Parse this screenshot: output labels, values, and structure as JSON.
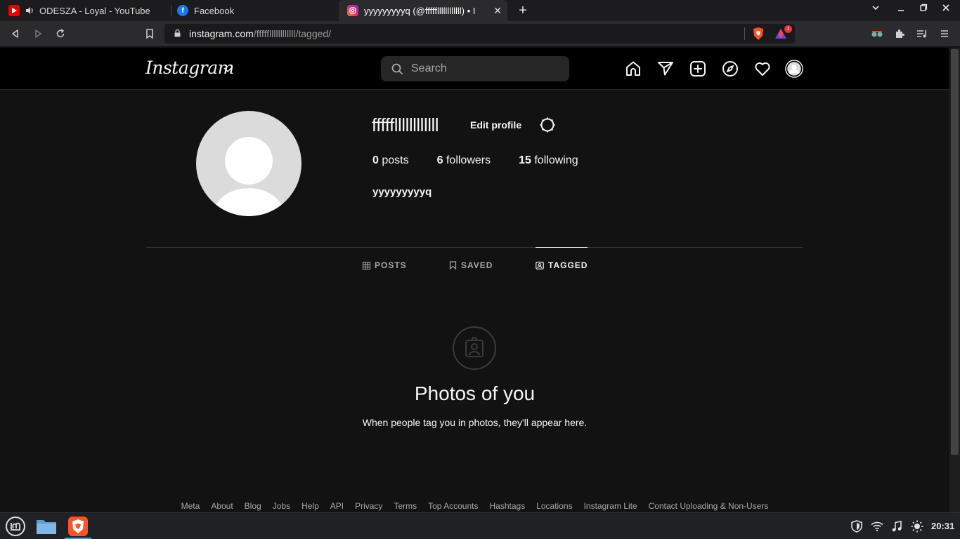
{
  "browser": {
    "tabs": [
      {
        "title": "ODESZA - Loyal - YouTube",
        "audio": true
      },
      {
        "title": "Facebook"
      },
      {
        "title": "yyyyyyyyyq (@fffffllllllllllll) • I",
        "active": true
      }
    ],
    "new_tab_label": "+",
    "url_host": "instagram.com",
    "url_path": "/fffffllllllllllll/tagged/",
    "brave_badge_count": "1"
  },
  "instagram": {
    "logo": "Instagram",
    "search_placeholder": "Search",
    "nav_icons": [
      "home-icon",
      "direct-icon",
      "new-post-icon",
      "explore-icon",
      "activity-icon",
      "profile-avatar"
    ]
  },
  "profile": {
    "username": "fffffllllllllllll",
    "edit_profile_label": "Edit profile",
    "posts_count": "0",
    "posts_label": "posts",
    "followers_count": "6",
    "followers_label": "followers",
    "following_count": "15",
    "following_label": "following",
    "full_name": "yyyyyyyyyq"
  },
  "profile_tabs": {
    "posts": "POSTS",
    "saved": "SAVED",
    "tagged": "TAGGED",
    "active": "TAGGED"
  },
  "empty_state": {
    "title": "Photos of you",
    "subtitle": "When people tag you in photos, they'll appear here."
  },
  "footer": {
    "links": [
      "Meta",
      "About",
      "Blog",
      "Jobs",
      "Help",
      "API",
      "Privacy",
      "Terms",
      "Top Accounts",
      "Hashtags",
      "Locations",
      "Instagram Lite",
      "Contact Uploading & Non-Users"
    ]
  },
  "taskbar": {
    "clock": "20:31"
  },
  "colors": {
    "background": "#121212",
    "header": "#000000",
    "search_bg": "#262626",
    "secondary_text": "#a8a8a8",
    "taskbar_accent": "#3a9de0"
  }
}
